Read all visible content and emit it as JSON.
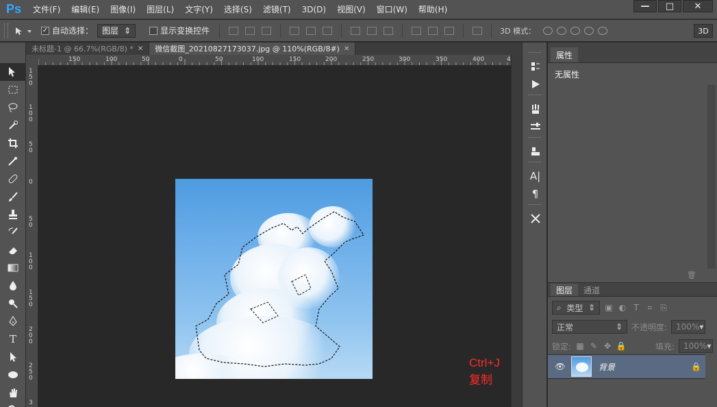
{
  "app": {
    "logo": "Ps",
    "window_buttons": [
      "—",
      "□",
      "✕"
    ]
  },
  "menu": [
    "文件(F)",
    "编辑(E)",
    "图像(I)",
    "图层(L)",
    "文字(Y)",
    "选择(S)",
    "滤镜(T)",
    "3D(D)",
    "视图(V)",
    "窗口(W)",
    "帮助(H)"
  ],
  "options": {
    "auto_select_label": "自动选择：",
    "auto_select_checked": true,
    "auto_select_value": "图层",
    "show_transform_label": "显示变换控件",
    "show_transform_checked": false,
    "mode_label": "3D 模式：",
    "btn_3d": "3D"
  },
  "tabs": [
    {
      "label": "未标题-1 @ 66.7%(RGB/8) *",
      "active": false
    },
    {
      "label": "微信截图_20210827173037.jpg @ 110%(RGB/8#)",
      "active": true
    }
  ],
  "ruler_top_labels": [
    "150",
    "100",
    "50",
    "0",
    "50",
    "100",
    "150",
    "200",
    "250",
    "300",
    "350",
    "400",
    "4"
  ],
  "ruler_left_labels": [
    "150",
    "100",
    "50",
    "0",
    "50",
    "100",
    "150",
    "200",
    "250",
    "3"
  ],
  "canvas": {
    "hint": "Ctrl+J复制"
  },
  "properties": {
    "tab": "属性",
    "body": "无属性"
  },
  "layers": {
    "tabs": [
      "图层",
      "通道"
    ],
    "filter_label": "类型",
    "blend_mode": "正常",
    "opacity_label": "不透明度:",
    "opacity_value": "100%",
    "lock_label": "锁定:",
    "fill_label": "填充:",
    "fill_value": "100%",
    "items": [
      {
        "name": "背景",
        "locked": true,
        "visible": true
      }
    ]
  }
}
